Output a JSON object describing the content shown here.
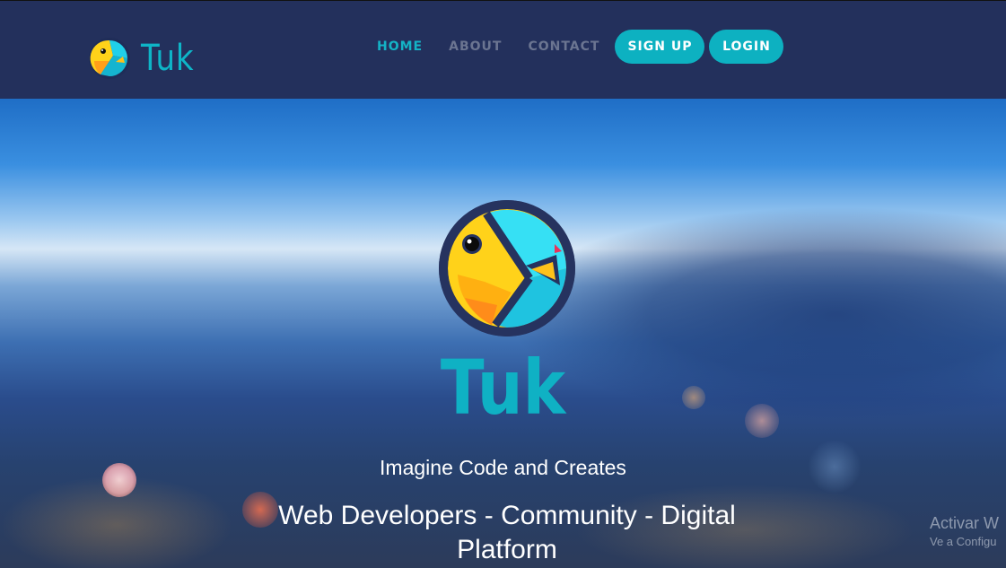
{
  "nav": {
    "brand": "Tuk",
    "links": [
      {
        "label": "HOME",
        "active": true
      },
      {
        "label": "ABOUT",
        "active": false
      },
      {
        "label": "CONTACT",
        "active": false
      }
    ],
    "signup_label": "SIGN UP",
    "login_label": "LOGIN"
  },
  "hero": {
    "title": "Tuk",
    "tagline": "Imagine Code and Creates",
    "subtitle": "Web Developers - Community - Digital Platform"
  },
  "watermark": {
    "line1": "Activar W",
    "line2": "Ve a Configu"
  },
  "colors": {
    "navbar": "#23305c",
    "accent": "#0db1c1",
    "nav_inactive": "#6b7591"
  }
}
